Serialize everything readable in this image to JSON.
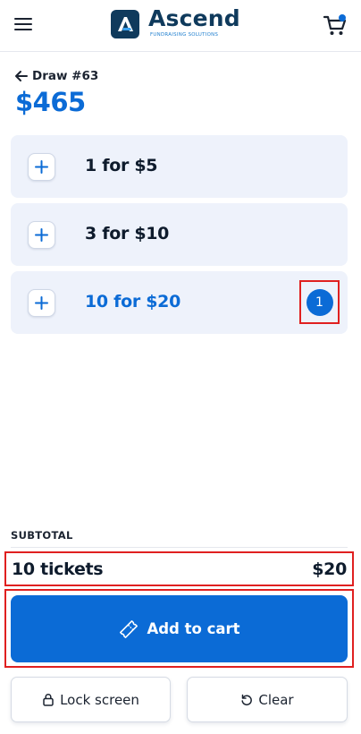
{
  "header": {
    "logo_text": "Ascend",
    "logo_subtitle": "FUNDRAISING SOLUTIONS",
    "brand_color": "#0f3a5c",
    "accent_color": "#0b6bd6",
    "icons": {
      "menu": "hamburger-menu-icon",
      "cart": "shopping-cart-icon"
    }
  },
  "draw": {
    "back_label": "Draw #63",
    "jackpot": "$465"
  },
  "options": [
    {
      "label": "1 for $5",
      "selected": false,
      "quantity": null
    },
    {
      "label": "3 for $10",
      "selected": false,
      "quantity": null
    },
    {
      "label": "10 for $20",
      "selected": true,
      "quantity": "1"
    }
  ],
  "subtotal": {
    "label": "SUBTOTAL",
    "tickets": "10 tickets",
    "amount": "$20"
  },
  "actions": {
    "add_to_cart": "Add to cart",
    "lock_screen": "Lock screen",
    "clear": "Clear"
  },
  "colors": {
    "highlight_outline": "#e02020",
    "option_background": "#eef2fb",
    "primary_button": "#0b6bd6"
  }
}
